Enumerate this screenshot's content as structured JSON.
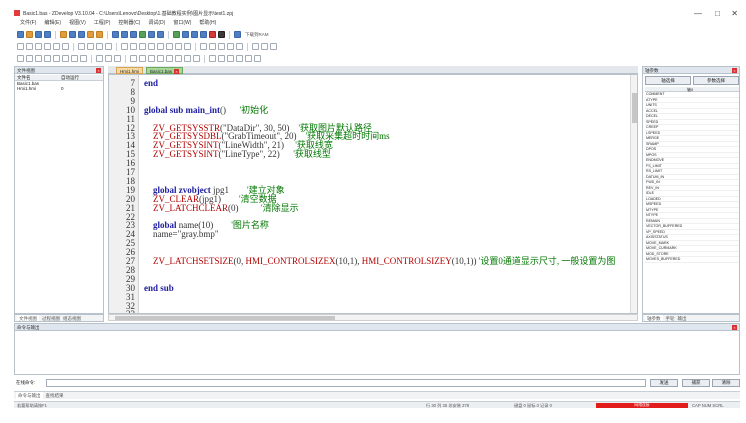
{
  "titlebar": {
    "title": "Basic1.bas - ZDevelop V3.10.04 - C:\\Users\\Lenovo\\Desktop\\1.基础教程实例\\图片显示\\test1.zpj",
    "controls": [
      "—",
      "□",
      "✕"
    ]
  },
  "menubar": [
    "文件(F)",
    "编辑(E)",
    "视图(V)",
    "工程(P)",
    "控制器(C)",
    "调试(D)",
    "窗口(W)",
    "帮助(H)"
  ],
  "toolbar": {
    "download_label": "下载到RAM"
  },
  "left_panel": {
    "title": "文件视图",
    "columns": [
      "文件名",
      "自动运行"
    ],
    "rows": [
      [
        "Basic1.bas",
        ""
      ],
      [
        "Hmi1.hmi",
        "0"
      ]
    ],
    "tabs": [
      "文件视图",
      "过程视图",
      "组态视图"
    ]
  },
  "editor": {
    "tabs": [
      "Hmi1.hmi",
      "Basic1.bas"
    ],
    "active_tab": 1,
    "lines": [
      {
        "n": "7",
        "t": "end"
      },
      {
        "n": "8",
        "t": ""
      },
      {
        "n": "9",
        "t": ""
      },
      {
        "n": "10",
        "t": "global sub main_int()      '初始化"
      },
      {
        "n": "11",
        "t": ""
      },
      {
        "n": "12",
        "t": "    ZV_GETSYSSTR(\"DataDir\", 30, 50)    '获取图片默认路径"
      },
      {
        "n": "13",
        "t": "    ZV_GETSYSDBL(\"GrabTimeout\", 20)    '获取采集超时时间ms"
      },
      {
        "n": "14",
        "t": "    ZV_GETSYSINT(\"LineWidth\", 21)     '获取线宽"
      },
      {
        "n": "15",
        "t": "    ZV_GETSYSINT(\"LineType\", 22)      '获取线型"
      },
      {
        "n": "16",
        "t": ""
      },
      {
        "n": "17",
        "t": ""
      },
      {
        "n": "18",
        "t": ""
      },
      {
        "n": "19",
        "t": "    global zvobject jpg1        '建立对象"
      },
      {
        "n": "20",
        "t": "    ZV_CLEAR(jpg1)        '清空数据"
      },
      {
        "n": "21",
        "t": "    ZV_LATCHCLEAR(0)          '清除显示"
      },
      {
        "n": "22",
        "t": ""
      },
      {
        "n": "23",
        "t": "    global name(10)        '图片名称"
      },
      {
        "n": "24",
        "t": "    name=\"gray.bmp\""
      },
      {
        "n": "25",
        "t": ""
      },
      {
        "n": "26",
        "t": ""
      },
      {
        "n": "27",
        "t": "    ZV_LATCHSETSIZE(0, HMI_CONTROLSIZEX(10,1), HMI_CONTROLSIZEY(10,1)) '设置0通道显示尺寸, 一般设置为图"
      },
      {
        "n": "28",
        "t": ""
      },
      {
        "n": "29",
        "t": ""
      },
      {
        "n": "30",
        "t": "end sub"
      },
      {
        "n": "31",
        "t": ""
      },
      {
        "n": "32",
        "t": ""
      },
      {
        "n": "33",
        "t": ""
      }
    ]
  },
  "right_panel": {
    "title": "轴参数",
    "buttons": [
      "轴选择",
      "参数选择"
    ],
    "columns": [
      "",
      "轴0"
    ],
    "rows": [
      "COMMENT",
      "ATYPE",
      "UNITS",
      "ACCEL",
      "DECEL",
      "SPEED",
      "CREEP",
      "LSPEED",
      "MERGE",
      "SRAMP",
      "DPOS",
      "MPOS",
      "ENDMOVE",
      "FS_LIMIT",
      "RS_LIMIT",
      "DATUM_IN",
      "FWD_IN",
      "REV_IN",
      "IDLE",
      "LOADED",
      "MSPEED",
      "MTYPE",
      "NTYPE",
      "REMAIN",
      "VECTOR_BUFFERED",
      "VP_SPEED",
      "AXISSTATUS",
      "MOVE_MARK",
      "MOVE_CURMARK",
      "MOD_STORE",
      "MOVES_BUFFERED"
    ],
    "tabs": [
      "轴参数",
      "手轮",
      "输出"
    ]
  },
  "output": {
    "title": "命令与输出",
    "cmd_label": "在线命令:",
    "send": "发送",
    "capture": "捕获",
    "clear": "清除",
    "tabs": [
      "命令与输出",
      "查找结果"
    ]
  },
  "status": {
    "left": "若要帮助请按F1",
    "pos": "行 30 列 35  非安装 278",
    "mid": "键盘 0 鼠标 0 记录 0",
    "connection": "网络连接",
    "right": "CAP NUM SCRL"
  }
}
